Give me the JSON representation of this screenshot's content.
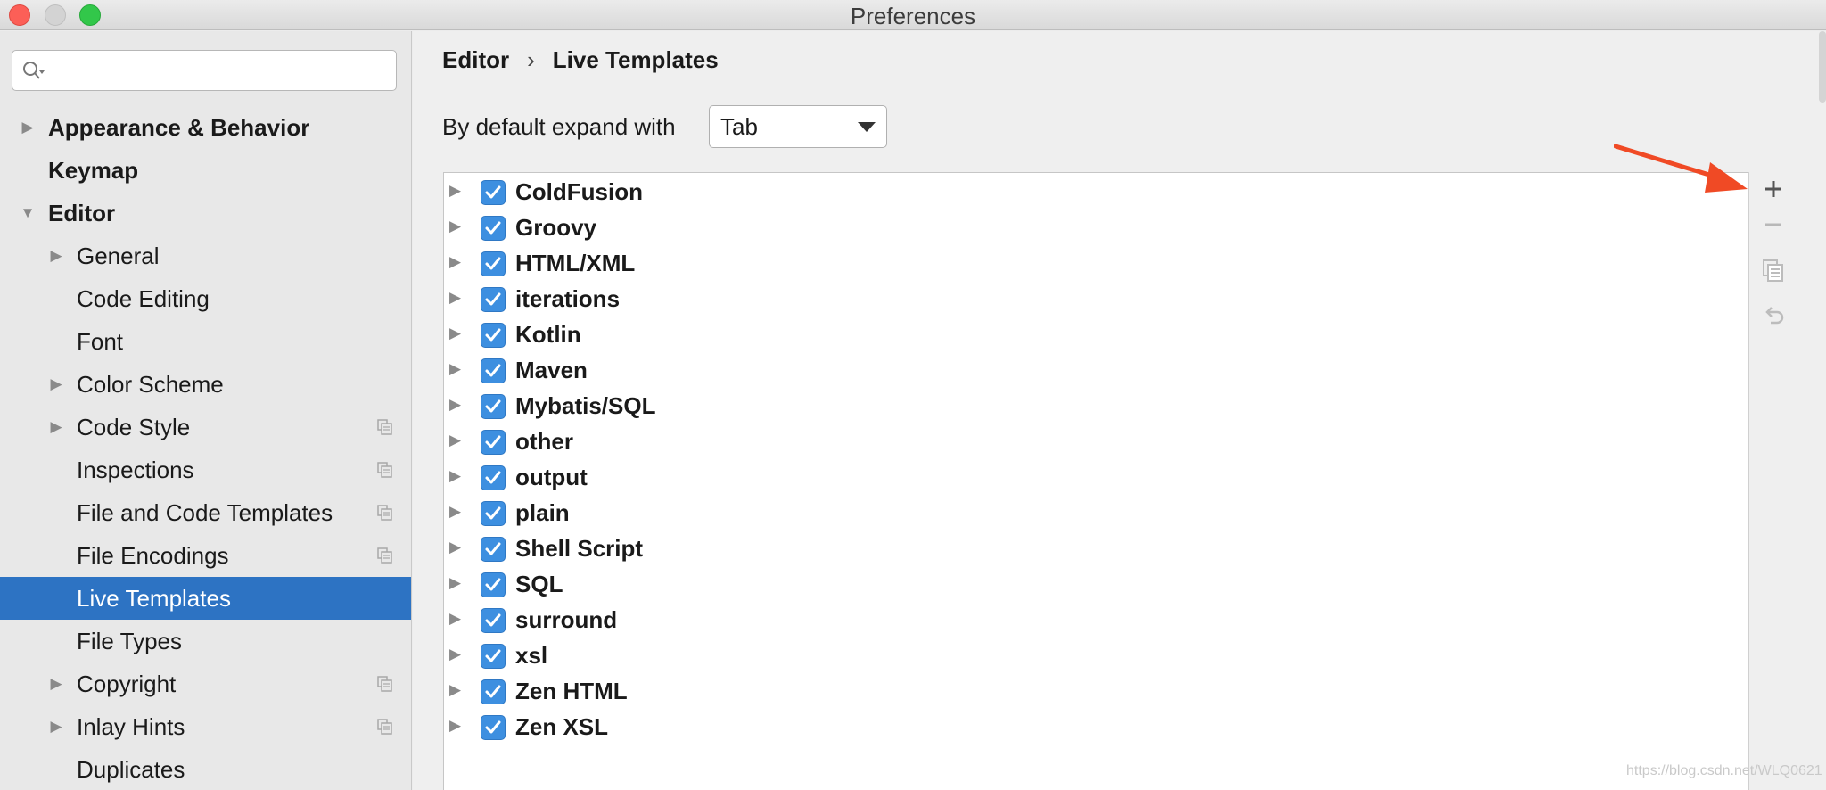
{
  "window": {
    "title": "Preferences"
  },
  "search": {
    "placeholder": ""
  },
  "sidebar": {
    "items": [
      {
        "label": "Appearance & Behavior",
        "level": 0,
        "arrow": "▶",
        "copy": false
      },
      {
        "label": "Keymap",
        "level": 0,
        "arrow": "",
        "copy": false
      },
      {
        "label": "Editor",
        "level": 0,
        "arrow": "▼",
        "copy": false
      },
      {
        "label": "General",
        "level": 1,
        "arrow": "▶",
        "copy": false
      },
      {
        "label": "Code Editing",
        "level": 1,
        "arrow": "",
        "copy": false
      },
      {
        "label": "Font",
        "level": 1,
        "arrow": "",
        "copy": false
      },
      {
        "label": "Color Scheme",
        "level": 1,
        "arrow": "▶",
        "copy": false
      },
      {
        "label": "Code Style",
        "level": 1,
        "arrow": "▶",
        "copy": true
      },
      {
        "label": "Inspections",
        "level": 1,
        "arrow": "",
        "copy": true
      },
      {
        "label": "File and Code Templates",
        "level": 1,
        "arrow": "",
        "copy": true
      },
      {
        "label": "File Encodings",
        "level": 1,
        "arrow": "",
        "copy": true
      },
      {
        "label": "Live Templates",
        "level": 1,
        "arrow": "",
        "copy": false,
        "selected": true
      },
      {
        "label": "File Types",
        "level": 1,
        "arrow": "",
        "copy": false
      },
      {
        "label": "Copyright",
        "level": 1,
        "arrow": "▶",
        "copy": true
      },
      {
        "label": "Inlay Hints",
        "level": 1,
        "arrow": "▶",
        "copy": true
      },
      {
        "label": "Duplicates",
        "level": 1,
        "arrow": "",
        "copy": false
      }
    ]
  },
  "breadcrumb": {
    "parent": "Editor",
    "separator": "›",
    "current": "Live Templates"
  },
  "expand": {
    "label": "By default expand with",
    "value": "Tab"
  },
  "templates": {
    "groups": [
      {
        "name": "ColdFusion",
        "checked": true
      },
      {
        "name": "Groovy",
        "checked": true
      },
      {
        "name": "HTML/XML",
        "checked": true
      },
      {
        "name": "iterations",
        "checked": true
      },
      {
        "name": "Kotlin",
        "checked": true
      },
      {
        "name": "Maven",
        "checked": true
      },
      {
        "name": "Mybatis/SQL",
        "checked": true
      },
      {
        "name": "other",
        "checked": true
      },
      {
        "name": "output",
        "checked": true
      },
      {
        "name": "plain",
        "checked": true
      },
      {
        "name": "Shell Script",
        "checked": true
      },
      {
        "name": "SQL",
        "checked": true
      },
      {
        "name": "surround",
        "checked": true
      },
      {
        "name": "xsl",
        "checked": true
      },
      {
        "name": "Zen HTML",
        "checked": true
      },
      {
        "name": "Zen XSL",
        "checked": true
      }
    ]
  },
  "toolbar": {
    "icons": [
      "plus-icon",
      "minus-icon",
      "copy-icon",
      "revert-icon"
    ]
  },
  "watermark": {
    "text": "https://blog.csdn.net/WLQ0621"
  },
  "colors": {
    "selection": "#2d73c3",
    "checkbox": "#3d8fe0",
    "annotation_arrow": "#f04a25"
  }
}
